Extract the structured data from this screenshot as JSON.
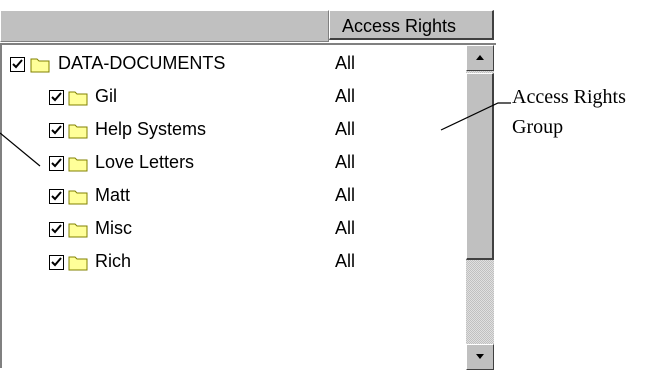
{
  "header": {
    "column_access": "Access Rights"
  },
  "tree": [
    {
      "label": "DATA-DOCUMENTS",
      "rights": "All",
      "checked": true,
      "level": 0
    },
    {
      "label": "Gil",
      "rights": "All",
      "checked": true,
      "level": 1
    },
    {
      "label": "Help Systems",
      "rights": "All",
      "checked": true,
      "level": 1
    },
    {
      "label": "Love Letters",
      "rights": "All",
      "checked": true,
      "level": 1
    },
    {
      "label": "Matt",
      "rights": "All",
      "checked": true,
      "level": 1
    },
    {
      "label": "Misc",
      "rights": "All",
      "checked": true,
      "level": 1
    },
    {
      "label": "Rich",
      "rights": "All",
      "checked": true,
      "level": 1
    }
  ],
  "callout": {
    "line1": "Access Rights",
    "line2": "Group"
  },
  "icons": {
    "checkbox": "checkbox-checked-icon",
    "folder": "folder-icon",
    "scroll_up": "arrow-up-icon",
    "scroll_down": "arrow-down-icon"
  },
  "colors": {
    "folder_fill": "#ffff99",
    "folder_outline": "#808000",
    "chrome": "#c0c0c0"
  }
}
